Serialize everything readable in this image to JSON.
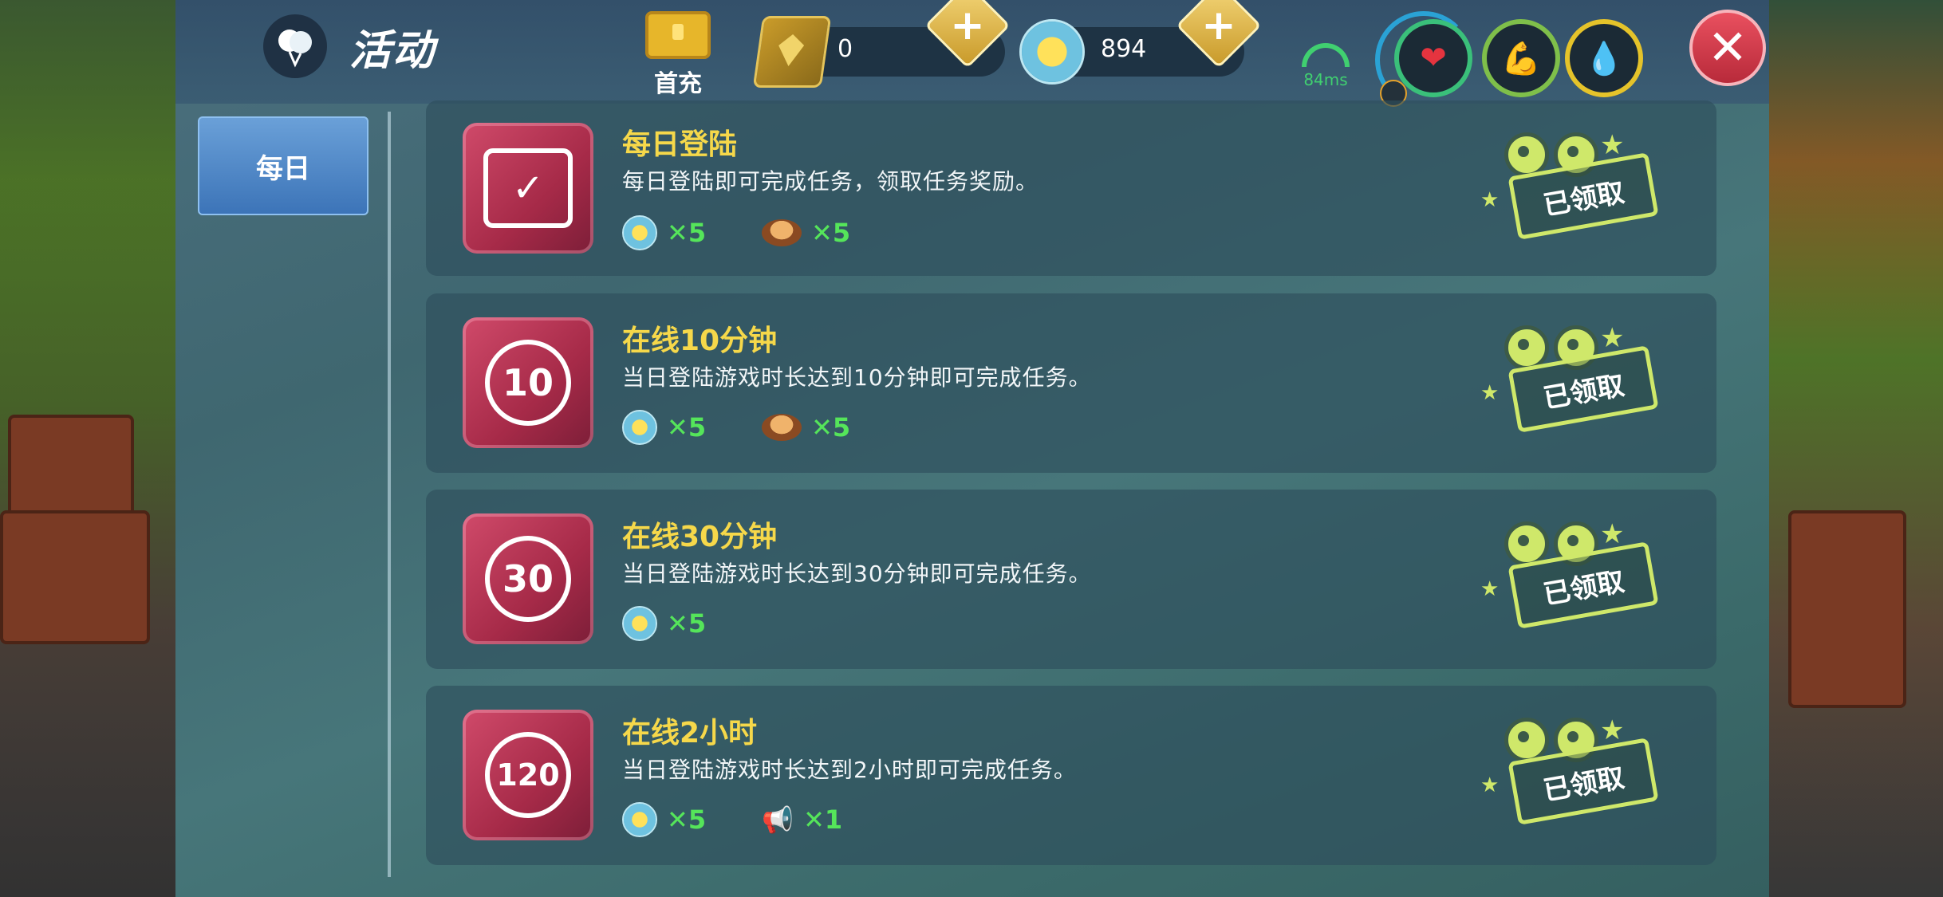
{
  "header": {
    "title": "活动",
    "first_charge_label": "首充",
    "gems": "0",
    "suns": "894",
    "ping": "84ms"
  },
  "sidebar": {
    "daily_tab": "每日"
  },
  "tasks": [
    {
      "title": "每日登陆",
      "desc": "每日登陆即可完成任务，领取任务奖励。",
      "icon": "calendar-check-icon",
      "rewards": [
        {
          "icon": "sun-coin-icon",
          "count": "✕5"
        },
        {
          "icon": "food-plate-icon",
          "count": "✕5"
        }
      ],
      "status": "已领取"
    },
    {
      "title": "在线10分钟",
      "desc": "当日登陆游戏时长达到10分钟即可完成任务。",
      "icon_text": "10",
      "rewards": [
        {
          "icon": "sun-coin-icon",
          "count": "✕5"
        },
        {
          "icon": "food-plate-icon",
          "count": "✕5"
        }
      ],
      "status": "已领取"
    },
    {
      "title": "在线30分钟",
      "desc": "当日登陆游戏时长达到30分钟即可完成任务。",
      "icon_text": "30",
      "rewards": [
        {
          "icon": "sun-coin-icon",
          "count": "✕5"
        }
      ],
      "status": "已领取"
    },
    {
      "title": "在线2小时",
      "desc": "当日登陆游戏时长达到2小时即可完成任务。",
      "icon_text": "120",
      "rewards": [
        {
          "icon": "sun-coin-icon",
          "count": "✕5"
        },
        {
          "icon": "megaphone-icon",
          "count": "✕1"
        }
      ],
      "status": "已领取"
    }
  ]
}
